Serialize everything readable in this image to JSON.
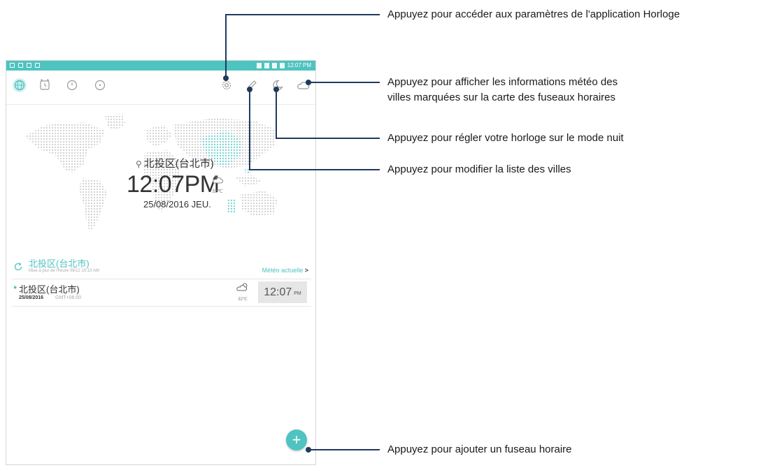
{
  "status_bar": {
    "time": "12:07 PM"
  },
  "tabs": [
    {
      "name": "world-clock",
      "icon": "globe-icon",
      "active": true
    },
    {
      "name": "alarm",
      "icon": "alarm-icon",
      "active": false
    },
    {
      "name": "stopwatch",
      "icon": "stopwatch-icon",
      "active": false
    },
    {
      "name": "timer",
      "icon": "timer-icon",
      "active": false
    }
  ],
  "actions": [
    "gear-icon",
    "pencil-icon",
    "moon-icon",
    "cloud-icon"
  ],
  "main_clock": {
    "location": "北投区(台北市)",
    "time": "12:07PM",
    "temp": "32℃",
    "date": "25/08/2016 JEU."
  },
  "weather": {
    "city": "北投区(台北市)",
    "updated": "Mise à jour de l'heure 09/12 10:15 AM",
    "link_label": "Météo actuelle",
    "link_arrow": ">"
  },
  "city_list": [
    {
      "city": "北投区(台北市)",
      "date": "25/08/2016",
      "gmt": "GMT+08:00",
      "temp": "32℃",
      "time": "12:07",
      "ampm": "PM"
    }
  ],
  "fab_label": "+",
  "callouts": {
    "settings": "Appuyez pour accéder aux paramètres de l'application Horloge",
    "weather_line1": "Appuyez pour afficher les informations météo des",
    "weather_line2": "villes marquées sur la carte des fuseaux horaires",
    "night_mode": "Appuyez pour régler votre horloge sur le mode nuit",
    "edit_cities": "Appuyez pour modifier la liste des villes",
    "add_timezone": "Appuyez pour ajouter un fuseau horaire"
  },
  "colors": {
    "accent": "#4fc3c0",
    "callout_line": "#1f3a5f"
  }
}
